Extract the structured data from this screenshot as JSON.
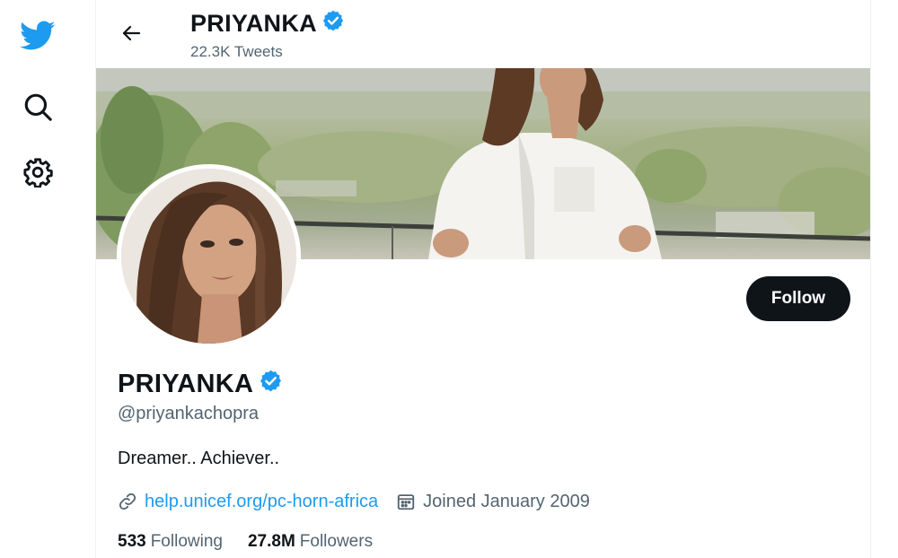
{
  "nav": {
    "items": [
      {
        "name": "twitter-logo",
        "icon": "twitter-bird-icon"
      },
      {
        "name": "explore",
        "icon": "search-icon"
      },
      {
        "name": "settings",
        "icon": "gear-icon"
      }
    ]
  },
  "header": {
    "name": "PRIYANKA",
    "tweet_count": "22.3K Tweets"
  },
  "profile": {
    "name": "PRIYANKA",
    "handle": "@priyankachopra",
    "bio": "Dreamer.. Achiever..",
    "website": "help.unicef.org/pc-horn-africa",
    "joined": "Joined January 2009",
    "following_count": "533",
    "following_label": "Following",
    "followers_count": "27.8M",
    "followers_label": "Followers",
    "follow_button": "Follow",
    "verified": true
  },
  "colors": {
    "brand": "#1d9bf0",
    "text_primary": "#0f1419",
    "text_secondary": "#536471",
    "button_dark": "#0f1419"
  }
}
